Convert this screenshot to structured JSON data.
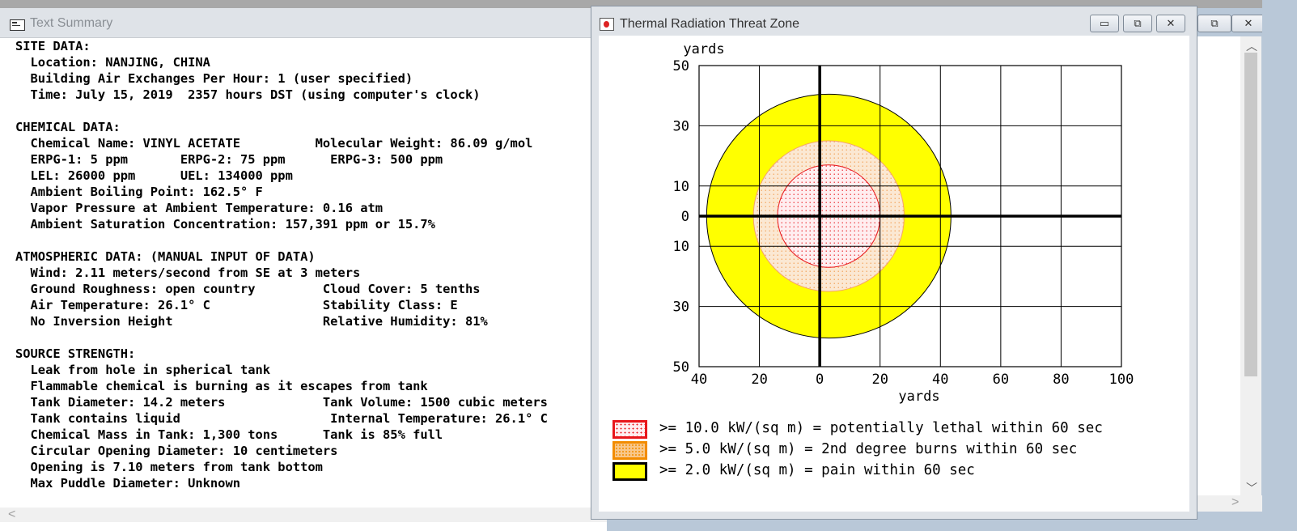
{
  "text_summary": {
    "title": "Text Summary",
    "lines": [
      "SITE DATA:",
      "  Location: NANJING, CHINA",
      "  Building Air Exchanges Per Hour: 1 (user specified)",
      "  Time: July 15, 2019  2357 hours DST (using computer's clock)",
      "",
      "CHEMICAL DATA:",
      "  Chemical Name: VINYL ACETATE          Molecular Weight: 86.09 g/mol",
      "  ERPG-1: 5 ppm       ERPG-2: 75 ppm      ERPG-3: 500 ppm",
      "  LEL: 26000 ppm      UEL: 134000 ppm",
      "  Ambient Boiling Point: 162.5° F",
      "  Vapor Pressure at Ambient Temperature: 0.16 atm",
      "  Ambient Saturation Concentration: 157,391 ppm or 15.7%",
      "",
      "ATMOSPHERIC DATA: (MANUAL INPUT OF DATA)",
      "  Wind: 2.11 meters/second from SE at 3 meters",
      "  Ground Roughness: open country         Cloud Cover: 5 tenths",
      "  Air Temperature: 26.1° C               Stability Class: E",
      "  No Inversion Height                    Relative Humidity: 81%",
      "",
      "SOURCE STRENGTH:",
      "  Leak from hole in spherical tank",
      "  Flammable chemical is burning as it escapes from tank",
      "  Tank Diameter: 14.2 meters             Tank Volume: 1500 cubic meters",
      "  Tank contains liquid                    Internal Temperature: 26.1° C",
      "  Chemical Mass in Tank: 1,300 tons      Tank is 85% full",
      "  Circular Opening Diameter: 10 centimeters",
      "  Opening is 7.10 meters from tank bottom",
      "  Max Puddle Diameter: Unknown"
    ]
  },
  "thermal_window": {
    "title": "Thermal Radiation Threat Zone",
    "buttons": {
      "minimize": "▭",
      "maximize": "⧉",
      "close": "✕"
    },
    "legend": [
      {
        "text": ">= 10.0 kW/(sq m) = potentially lethal within 60 sec",
        "swatch_color": "#ffe9e9",
        "border_color": "#e8161b"
      },
      {
        "text": ">= 5.0 kW/(sq m) = 2nd degree burns within 60 sec",
        "swatch_color": "#f8c78a",
        "border_color": "#f28c00"
      },
      {
        "text": ">= 2.0 kW/(sq m) = pain within 60 sec",
        "swatch_color": "#ffff00",
        "border_color": "#000000"
      }
    ]
  },
  "chart_data": {
    "type": "threat-zone-plot",
    "y_unit_label": "yards",
    "x_unit_label": "yards",
    "x_ticks": [
      "40",
      "20",
      "0",
      "20",
      "40",
      "60",
      "80",
      "100"
    ],
    "x_tick_values": [
      -40,
      -20,
      0,
      20,
      40,
      60,
      80,
      100
    ],
    "y_ticks": [
      "50",
      "30",
      "10",
      "0",
      "10",
      "30",
      "50"
    ],
    "y_tick_values": [
      50,
      30,
      10,
      0,
      -10,
      -30,
      -50
    ],
    "xlim": [
      -40,
      100
    ],
    "ylim": [
      -50,
      50
    ],
    "grid": true,
    "zones": [
      {
        "name": ">= 2.0 kW/(sq m)",
        "center_x": 3,
        "center_y": 0,
        "radius": 40.5,
        "fill": "#ffff00",
        "stroke": "#000000"
      },
      {
        "name": ">= 5.0 kW/(sq m)",
        "center_x": 3,
        "center_y": 0,
        "radius": 25,
        "fill": "#fae6cf",
        "stroke": "#f5a36b"
      },
      {
        "name": ">= 10.0 kW/(sq m)",
        "center_x": 3,
        "center_y": 0,
        "radius": 17,
        "fill": "#ffeded",
        "stroke": "#e8161b"
      }
    ]
  },
  "background_window": {
    "buttons": {
      "restore": "⧉",
      "close": "✕"
    },
    "scroll_up": "︿",
    "scroll_down": "﹀",
    "scroll_left": "<",
    "scroll_right": ">"
  }
}
